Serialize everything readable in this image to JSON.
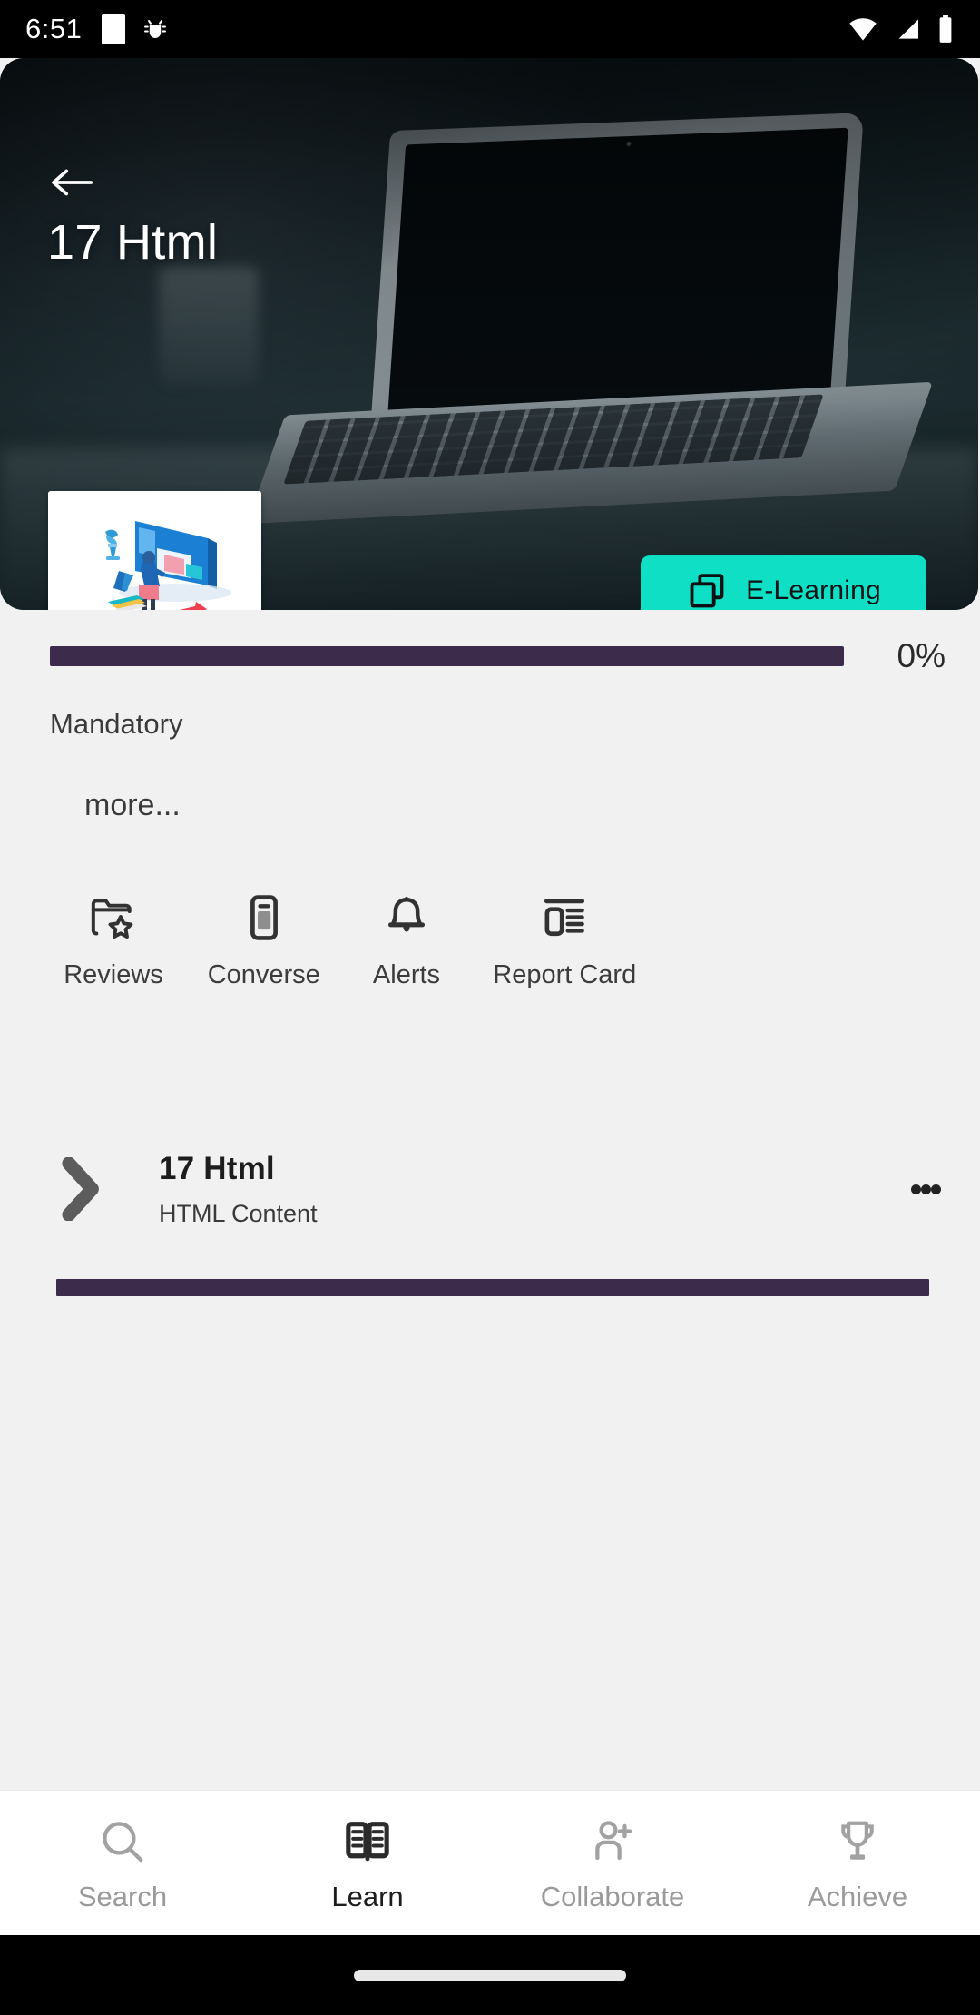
{
  "status_bar": {
    "time": "6:51",
    "left_icons": [
      "screenshot-indicator",
      "android-debug-icon"
    ],
    "right_icons": [
      "wifi-icon",
      "cellular-signal-icon",
      "battery-icon"
    ]
  },
  "hero": {
    "back_icon": "back-arrow-icon",
    "title": "17 Html",
    "thumbnail_alt": "e-learning-illustration",
    "badge": {
      "label": "E-Learning",
      "icon": "layers-copy-icon",
      "background": "#0fdfc4",
      "text_color": "#0d1214"
    },
    "background_image": "laptop-on-desk-photo"
  },
  "progress": {
    "percent_label": "0%",
    "value": 0,
    "fill_color": "#3c2b4b",
    "track_color": "#e3e1e4"
  },
  "labels": {
    "mandatory": "Mandatory",
    "more": "more..."
  },
  "actions": [
    {
      "label": "Reviews",
      "icon": "folder-star-icon"
    },
    {
      "label": "Converse",
      "icon": "mobile-device-icon"
    },
    {
      "label": "Alerts",
      "icon": "bell-icon"
    },
    {
      "label": "Report Card",
      "icon": "report-card-icon"
    }
  ],
  "content_item": {
    "expand_icon": "chevron-right-icon",
    "title": "17 Html",
    "subtitle": "HTML Content",
    "menu_icon": "kebab-menu-icon",
    "bar_color": "#3c2b4b"
  },
  "bottom_nav": {
    "active_index": 1,
    "items": [
      {
        "label": "Search",
        "icon": "search-icon"
      },
      {
        "label": "Learn",
        "icon": "open-book-icon"
      },
      {
        "label": "Collaborate",
        "icon": "person-add-icon"
      },
      {
        "label": "Achieve",
        "icon": "trophy-icon"
      }
    ]
  },
  "system_nav": {
    "gesture_pill": "home-gesture-pill"
  }
}
